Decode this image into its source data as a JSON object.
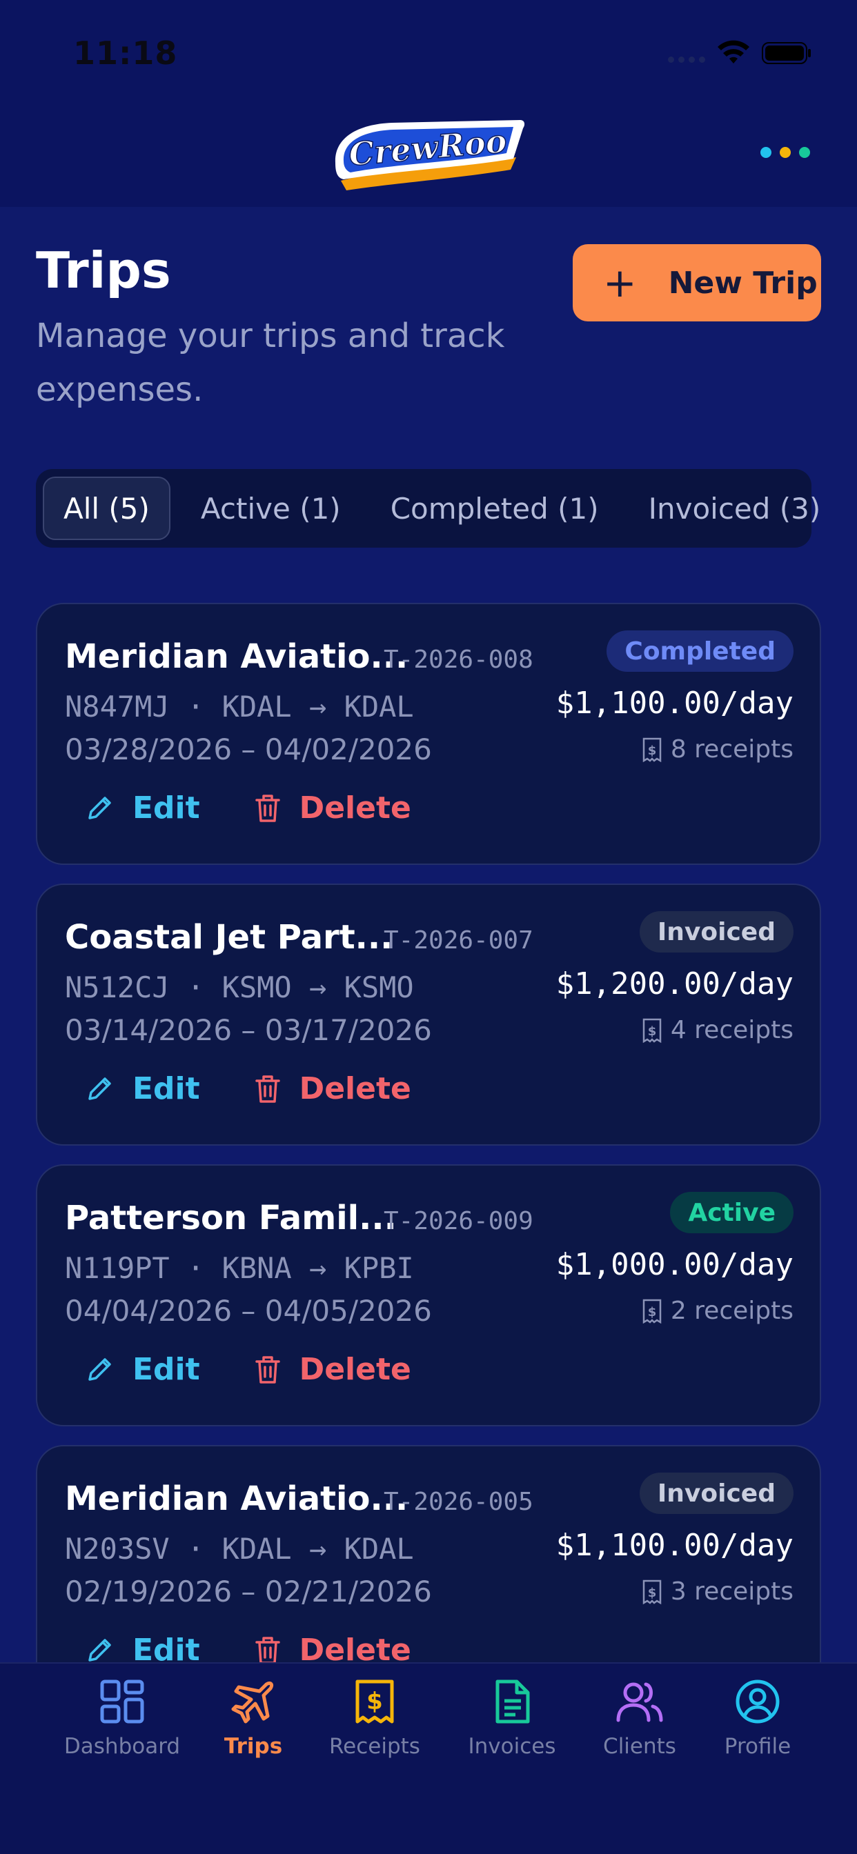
{
  "status_bar": {
    "time": "11:18"
  },
  "header": {
    "logo_text": "CrewRoo"
  },
  "page": {
    "title": "Trips",
    "subtitle": "Manage your trips and track expenses.",
    "new_trip_label": "New Trip"
  },
  "filters": [
    {
      "label": "All (5)",
      "active": true
    },
    {
      "label": "Active (1)",
      "active": false
    },
    {
      "label": "Completed (1)",
      "active": false
    },
    {
      "label": "Invoiced (3)",
      "active": false
    }
  ],
  "trips": [
    {
      "name": "Meridian Aviatio...",
      "code": "T-2026-008",
      "status": "Completed",
      "route": "N847MJ · KDAL → KDAL",
      "dates": "03/28/2026 – 04/02/2026",
      "rate": "$1,100.00/day",
      "receipts": "8 receipts",
      "edit_label": "Edit",
      "delete_label": "Delete"
    },
    {
      "name": "Coastal Jet Part...",
      "code": "T-2026-007",
      "status": "Invoiced",
      "route": "N512CJ · KSMO → KSMO",
      "dates": "03/14/2026 – 03/17/2026",
      "rate": "$1,200.00/day",
      "receipts": "4 receipts",
      "edit_label": "Edit",
      "delete_label": "Delete"
    },
    {
      "name": "Patterson Famil...",
      "code": "T-2026-009",
      "status": "Active",
      "route": "N119PT · KBNA → KPBI",
      "dates": "04/04/2026 – 04/05/2026",
      "rate": "$1,000.00/day",
      "receipts": "2 receipts",
      "edit_label": "Edit",
      "delete_label": "Delete"
    },
    {
      "name": "Meridian Aviatio...",
      "code": "T-2026-005",
      "status": "Invoiced",
      "route": "N203SV · KDAL → KDAL",
      "dates": "02/19/2026 – 02/21/2026",
      "rate": "$1,100.00/day",
      "receipts": "3 receipts",
      "edit_label": "Edit",
      "delete_label": "Delete"
    }
  ],
  "tabbar": [
    {
      "label": "Dashboard",
      "icon": "dashboard-icon",
      "color": "#5b8def"
    },
    {
      "label": "Trips",
      "icon": "plane-icon",
      "color": "#fb8a4b",
      "current": true
    },
    {
      "label": "Receipts",
      "icon": "receipt-icon",
      "color": "#f5b50a"
    },
    {
      "label": "Invoices",
      "icon": "document-icon",
      "color": "#18c99a"
    },
    {
      "label": "Clients",
      "icon": "users-icon",
      "color": "#b46ef5"
    },
    {
      "label": "Profile",
      "icon": "user-circle-icon",
      "color": "#22c3ee"
    }
  ],
  "colors": {
    "accent": "#fb8a4b",
    "background": "#0f1a6b",
    "card": "#0c1747"
  }
}
